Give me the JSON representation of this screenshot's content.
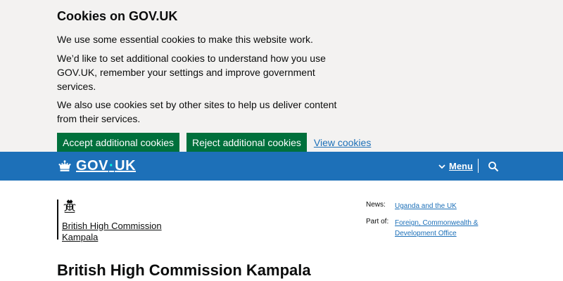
{
  "cookie_banner": {
    "title": "Cookies on GOV.UK",
    "p1": "We use some essential cookies to make this website work.",
    "p2": "We’d like to set additional cookies to understand how you use GOV.UK, remember your settings and improve government services.",
    "p3": "We also use cookies set by other sites to help us deliver content from their services.",
    "accept_label": "Accept additional cookies",
    "reject_label": "Reject additional cookies",
    "view_label": "View cookies"
  },
  "header": {
    "logo_part1": "GOV",
    "logo_dot": "·",
    "logo_part2": "UK",
    "menu_label": "Menu",
    "menu_icon": "chevron-down-icon",
    "search_icon": "search-icon"
  },
  "organisation": {
    "line1": "British High Commission",
    "line2": "Kampala"
  },
  "related": {
    "news_label": "News:",
    "news_link": "Uganda and the UK",
    "partof_label": "Part of:",
    "partof_link": "Foreign, Commonwealth & Development Office"
  },
  "page": {
    "title": "British High Commission Kampala"
  },
  "colors": {
    "banner_bg": "#f3f2f1",
    "header_bg": "#1d70b8",
    "button_green": "#00703c",
    "link_blue": "#1d70b8"
  }
}
